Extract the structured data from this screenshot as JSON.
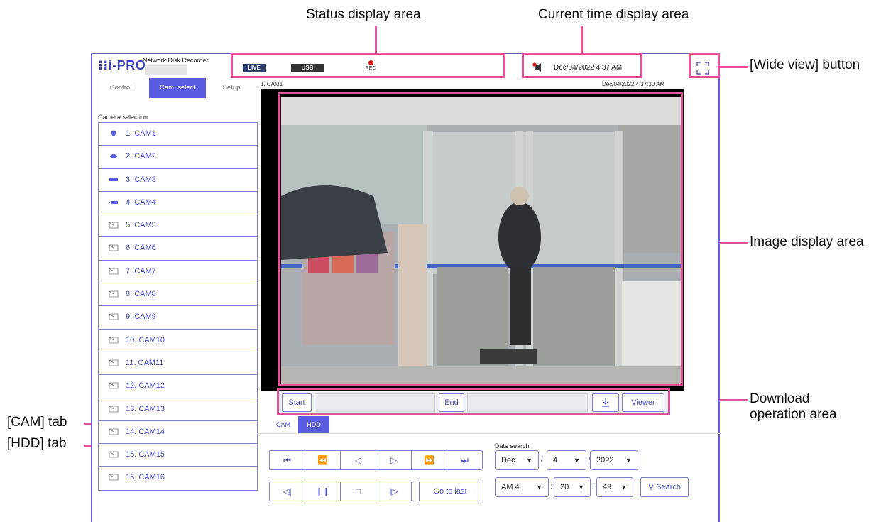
{
  "callouts": {
    "status_area": "Status display area",
    "time_area": "Current time display area",
    "wide_view": "[Wide view] button",
    "image_area": "Image display area",
    "download_1": "Download",
    "download_2": "operation area",
    "cam_tab": "[CAM] tab",
    "hdd_tab": "[HDD] tab"
  },
  "header": {
    "logo": "i-PRO",
    "subtitle": "Network Disk Recorder"
  },
  "status": {
    "live": "LIVE",
    "usb": "USB",
    "rec": "REC"
  },
  "time": {
    "current": "Dec/04/2022 4:37 AM"
  },
  "tabs": [
    {
      "label": "Control"
    },
    {
      "label": "Cam. select"
    },
    {
      "label": "Setup"
    }
  ],
  "camera_selection": {
    "title": "Camera selection",
    "items": [
      {
        "label": "1. CAM1",
        "icon": "dome-camera-icon"
      },
      {
        "label": "2. CAM2",
        "icon": "ptz-camera-icon"
      },
      {
        "label": "3. CAM3",
        "icon": "box-camera-icon"
      },
      {
        "label": "4. CAM4",
        "icon": "bullet-camera-icon"
      },
      {
        "label": "5. CAM5",
        "icon": "no-signal-camera-icon"
      },
      {
        "label": "6. CAM6",
        "icon": "no-signal-camera-icon"
      },
      {
        "label": "7. CAM7",
        "icon": "no-signal-camera-icon"
      },
      {
        "label": "8. CAM8",
        "icon": "no-signal-camera-icon"
      },
      {
        "label": "9. CAM9",
        "icon": "no-signal-camera-icon"
      },
      {
        "label": "10. CAM10",
        "icon": "no-signal-camera-icon"
      },
      {
        "label": "11. CAM11",
        "icon": "no-signal-camera-icon"
      },
      {
        "label": "12. CAM12",
        "icon": "no-signal-camera-icon"
      },
      {
        "label": "13. CAM13",
        "icon": "no-signal-camera-icon"
      },
      {
        "label": "14. CAM14",
        "icon": "no-signal-camera-icon"
      },
      {
        "label": "15. CAM15",
        "icon": "no-signal-camera-icon"
      },
      {
        "label": "16. CAM16",
        "icon": "no-signal-camera-icon"
      }
    ]
  },
  "image": {
    "camera": "1. CAM1",
    "timestamp": "Dec/04/2022 4:37:30 AM"
  },
  "download": {
    "start": "Start",
    "end": "End",
    "viewer": "Viewer"
  },
  "play_tabs": {
    "cam": "CAM",
    "hdd": "HDD"
  },
  "playback": {
    "go_to_last": "Go to last"
  },
  "date_search": {
    "title": "Date search",
    "month": "Dec",
    "day": "4",
    "year": "2022",
    "hour": "AM 4",
    "minute": "20",
    "second": "49",
    "search": "Search"
  },
  "colors": {
    "accent": "#5a5ce0",
    "callout": "#e8509a"
  }
}
